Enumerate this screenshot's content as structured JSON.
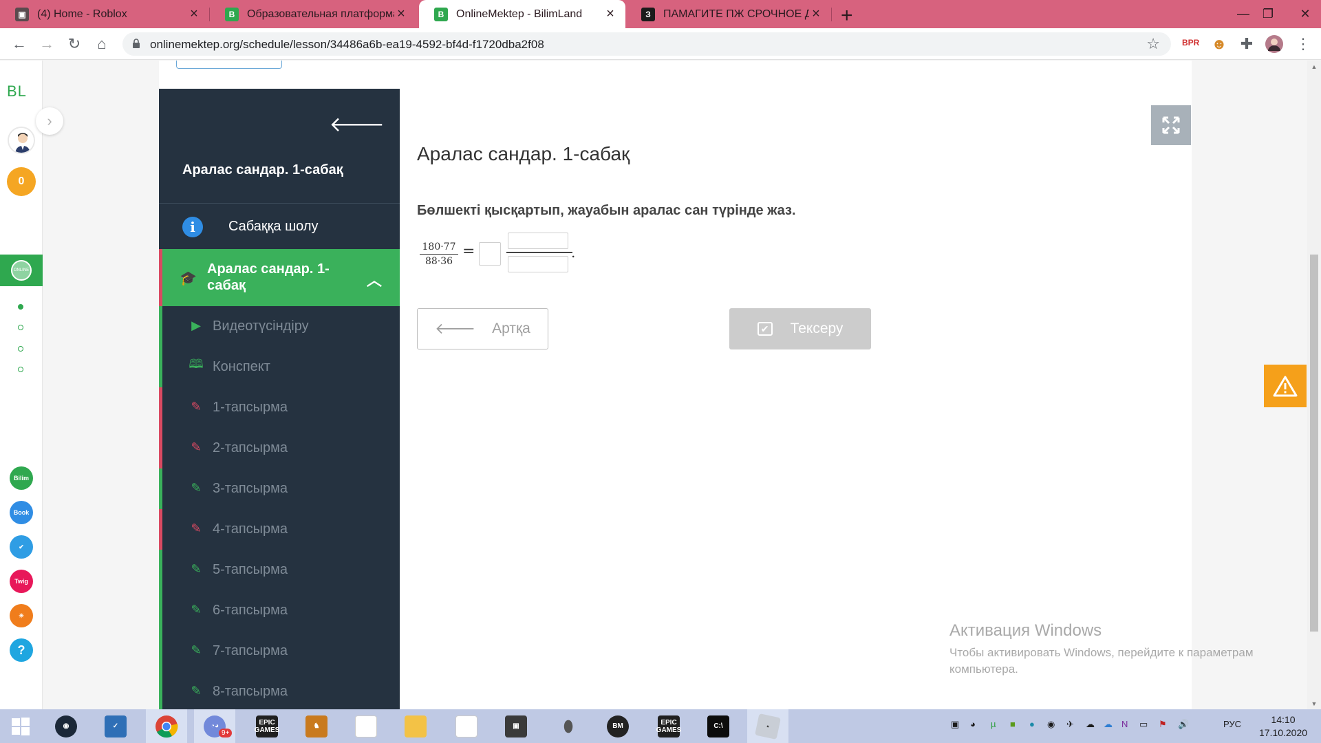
{
  "browser": {
    "tabs": [
      {
        "title": "(4) Home - Roblox",
        "favicon": "roblox-icon",
        "active": false
      },
      {
        "title": "Образовательная платформа для",
        "favicon": "bilimland-icon",
        "active": false
      },
      {
        "title": "OnlineMektep - BilimLand",
        "favicon": "bilimland-icon",
        "active": true
      },
      {
        "title": "ПАМАГИТЕ ПЖ СРОЧНОЕ ДЕЛО",
        "favicon": "znanija-icon",
        "active": false
      }
    ],
    "new_tab": "+",
    "url": "onlinemektep.org/schedule/lesson/34486a6b-ea19-4592-bf4d-f1720dba2f08",
    "extensions": [
      "BPR"
    ],
    "colors": {
      "tabstrip": "#d7627e",
      "toolbar": "#ffffff"
    }
  },
  "left_rail": {
    "logo": "BL",
    "points_badge": "0",
    "apps": [
      "bilimland-icon",
      "bilimbook-icon",
      "itest-icon",
      "twig-icon",
      "imektep-icon",
      "help-icon"
    ],
    "help_glyph": "?"
  },
  "sidebar": {
    "title": "Аралас сандар. 1-сабақ",
    "overview_label": "Сабаққа шолу",
    "active_section_label": "Аралас сандар. 1-сабақ",
    "items": [
      {
        "label": "Видеотүсіндіру",
        "icon": "play-icon",
        "status": "green"
      },
      {
        "label": "Конспект",
        "icon": "book-icon",
        "status": "green"
      },
      {
        "label": "1-тапсырма",
        "icon": "edit-icon",
        "status": "red"
      },
      {
        "label": "2-тапсырма",
        "icon": "edit-icon",
        "status": "red"
      },
      {
        "label": "3-тапсырма",
        "icon": "edit-icon",
        "status": "green"
      },
      {
        "label": "4-тапсырма",
        "icon": "edit-icon",
        "status": "red"
      },
      {
        "label": "5-тапсырма",
        "icon": "edit-icon",
        "status": "green"
      },
      {
        "label": "6-тапсырма",
        "icon": "edit-icon",
        "status": "green"
      },
      {
        "label": "7-тапсырма",
        "icon": "edit-icon",
        "status": "green"
      },
      {
        "label": "8-тапсырма",
        "icon": "edit-icon",
        "status": "green"
      }
    ],
    "colors": {
      "background": "#253240",
      "active": "#3ab15b",
      "green": "#3ab15b",
      "red": "#d94a62"
    }
  },
  "lesson": {
    "title": "Аралас сандар. 1-сабақ",
    "task": "Бөлшекті қысқартып, жауабын аралас сан түрінде жаз.",
    "equation": {
      "numerator": "180·77",
      "denominator": "88·36",
      "equals": "=",
      "end": ".",
      "whole_value": "",
      "numerator_value": "",
      "denominator_value": ""
    },
    "back_button": "Артқа",
    "check_button": "Тексеру"
  },
  "watermark": {
    "title": "Активация Windows",
    "text": "Чтобы активировать Windows, перейдите к параметрам компьютера."
  },
  "taskbar": {
    "apps": [
      "windows-start-icon",
      "steam-icon",
      "task-app-icon",
      "chrome-icon",
      "discord-icon",
      "epic-games-icon",
      "csgo-icon",
      "file-icon",
      "folder-icon",
      "file-icon",
      "app-icon",
      "mouse-icon",
      "bm-icon",
      "epic-games-icon",
      "terminal-icon",
      "roblox-icon"
    ],
    "epic_label": "EPIC GAMES",
    "bm_label": "BM",
    "discord_badge": "9+",
    "language": "РУС",
    "time": "14:10",
    "date": "17.10.2020"
  }
}
